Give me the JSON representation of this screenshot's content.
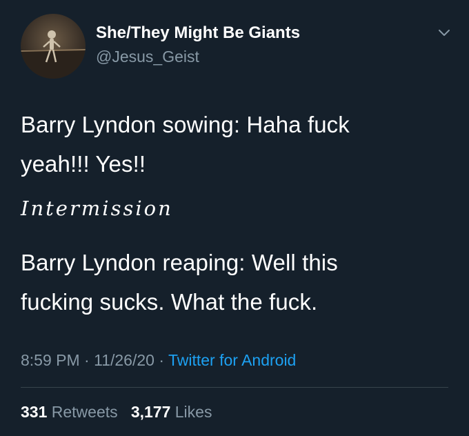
{
  "user": {
    "display_name": "She/They Might Be Giants",
    "handle": "@Jesus_Geist",
    "avatar_icon": "skeleton-figure-avatar"
  },
  "tweet": {
    "lines": [
      "Barry Lyndon sowing: Haha fuck",
      "yeah!!! Yes!!",
      "Barry Lyndon reaping: Well this",
      "fucking sucks. What the fuck."
    ],
    "intermission": "Intermission"
  },
  "meta": {
    "time": "8:59 PM",
    "date": "11/26/20",
    "separator": "·",
    "source": "Twitter for Android"
  },
  "stats": {
    "retweets_count": "331",
    "retweets_label": "Retweets",
    "likes_count": "3,177",
    "likes_label": "Likes"
  },
  "colors": {
    "background": "#15202b",
    "text": "#ffffff",
    "secondary": "#8899a6",
    "accent": "#1da1f2",
    "divider": "#38444d"
  },
  "icons": {
    "menu": "chevron-down-icon"
  }
}
